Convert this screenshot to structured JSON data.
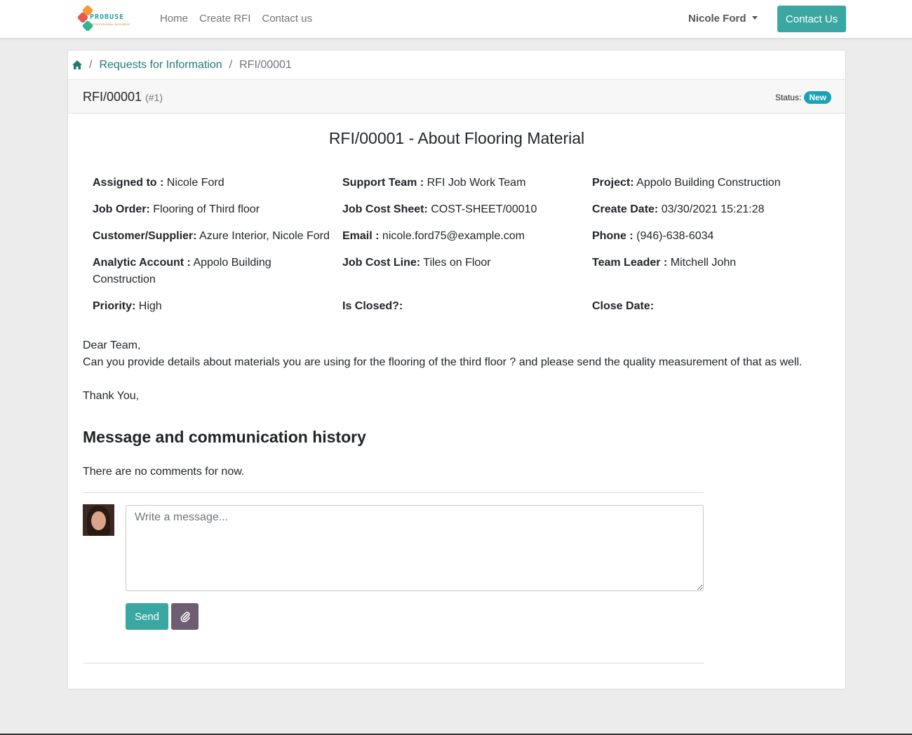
{
  "navbar": {
    "logo_text": "PROBUSE",
    "logo_tagline": "PROFESSIONAL BUSINESS",
    "links": [
      "Home",
      "Create RFI",
      "Contact us"
    ],
    "user_name": "Nicole Ford",
    "contact_button": "Contact Us"
  },
  "breadcrumb": {
    "separator": "/",
    "parent": "Requests for Information",
    "current": "RFI/00001"
  },
  "header": {
    "reference": "RFI/00001",
    "number": "(#1)",
    "status_label": "Status:",
    "status_value": "New"
  },
  "rfi": {
    "title": "RFI/00001 - About Flooring Material",
    "fields": {
      "assigned_to": {
        "label": "Assigned to :",
        "value": "Nicole Ford"
      },
      "support_team": {
        "label": "Support Team :",
        "value": "RFI Job Work Team"
      },
      "project": {
        "label": "Project:",
        "value": "Appolo Building Construction"
      },
      "job_order": {
        "label": "Job Order:",
        "value": "Flooring of Third floor"
      },
      "job_cost_sheet": {
        "label": "Job Cost Sheet:",
        "value": "COST-SHEET/00010"
      },
      "create_date": {
        "label": "Create Date:",
        "value": "03/30/2021 15:21:28"
      },
      "customer_supplier": {
        "label": "Customer/Supplier:",
        "value": "Azure Interior, Nicole Ford"
      },
      "email": {
        "label": "Email :",
        "value": "nicole.ford75@example.com"
      },
      "phone": {
        "label": "Phone :",
        "value": "(946)-638-6034"
      },
      "analytic_account_line1": {
        "label": "Analytic Account :",
        "value": "Appolo Building"
      },
      "analytic_account_line2": {
        "value": "Construction"
      },
      "job_cost_line": {
        "label": "Job Cost Line:",
        "value": "Tiles on Floor"
      },
      "team_leader": {
        "label": "Team Leader :",
        "value": "Mitchell John"
      },
      "priority": {
        "label": "Priority:",
        "value": "High"
      },
      "is_closed": {
        "label": "Is Closed?:",
        "value": ""
      },
      "close_date": {
        "label": "Close Date:",
        "value": ""
      }
    },
    "body": {
      "greeting": "Dear Team,",
      "message": "Can you provide details about materials you are using for the flooring of the third floor ? and please send the quality measurement of that as well.",
      "closing": "Thank You,"
    }
  },
  "history": {
    "heading": "Message and communication history",
    "empty_text": "There are no comments for now.",
    "composer_placeholder": "Write a message...",
    "send_label": "Send"
  },
  "colors": {
    "accent": "#3aa7a3",
    "link": "#227a77",
    "badge": "#17a2b8",
    "attach_button": "#6e5c72"
  }
}
